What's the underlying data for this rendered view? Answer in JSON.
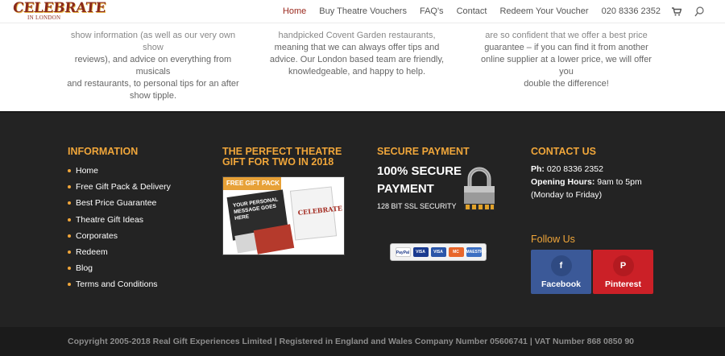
{
  "header": {
    "logo_main": "CELEBRATE",
    "logo_sub": "IN LONDON",
    "nav": [
      "Home",
      "Buy Theatre Vouchers",
      "FAQ's",
      "Contact",
      "Redeem Your Voucher",
      "020 8336 2352"
    ]
  },
  "top": {
    "col1": [
      "show information (as well as our very own show",
      "reviews), and advice on everything from musicals",
      "and restaurants, to personal tips for an after",
      "show tipple."
    ],
    "col2": [
      "handpicked Covent Garden restaurants,",
      "meaning that we can always offer tips and",
      "advice. Our London based team are friendly,",
      "knowledgeable, and happy to help."
    ],
    "col3": [
      "are so confident that we offer a best price",
      "guarantee – if you can find it from another",
      "online supplier at a lower price, we will offer you",
      "double the difference!"
    ]
  },
  "footer": {
    "information": {
      "heading": "INFORMATION",
      "items": [
        "Home",
        "Free Gift Pack & Delivery",
        "Best Price Guarantee",
        "Theatre Gift Ideas",
        "Corporates",
        "Redeem",
        "Blog",
        "Terms and Conditions"
      ]
    },
    "gift": {
      "heading_line1": "THE PERFECT THEATRE",
      "heading_line2": "GIFT FOR TWO IN 2018",
      "ribbon": "FREE GIFT PACK",
      "card_text": "YOUR PERSONAL MESSAGE GOES HERE",
      "card_logo": "CELEBRATE"
    },
    "payment": {
      "heading": "SECURE PAYMENT",
      "title_line1": "100% SECURE",
      "title_line2": "PAYMENT",
      "ssl": "128 BIT SSL SECURITY",
      "cards": [
        "PayPal",
        "VISA",
        "VISA",
        "MC",
        "MAESTRO"
      ]
    },
    "contact": {
      "heading": "CONTACT US",
      "phone_label": "Ph:",
      "phone": "020 8336 2352",
      "hours_label": "Opening Hours:",
      "hours": "9am to 5pm",
      "hours_note": "(Monday to Friday)",
      "follow_heading": "Follow Us",
      "facebook": "Facebook",
      "facebook_icon": "f",
      "pinterest": "Pinterest",
      "pinterest_icon": "P"
    },
    "copyright": "Copyright 2005-2018 Real Gift Experiences Limited | Registered in England and Wales Company Number 05606741 | VAT Number 868 0850 90"
  },
  "colors": {
    "accent": "#f0a63a",
    "brand": "#9b2a1f",
    "footer_bg": "#232323",
    "facebook": "#3b5998",
    "pinterest": "#cb2027"
  }
}
